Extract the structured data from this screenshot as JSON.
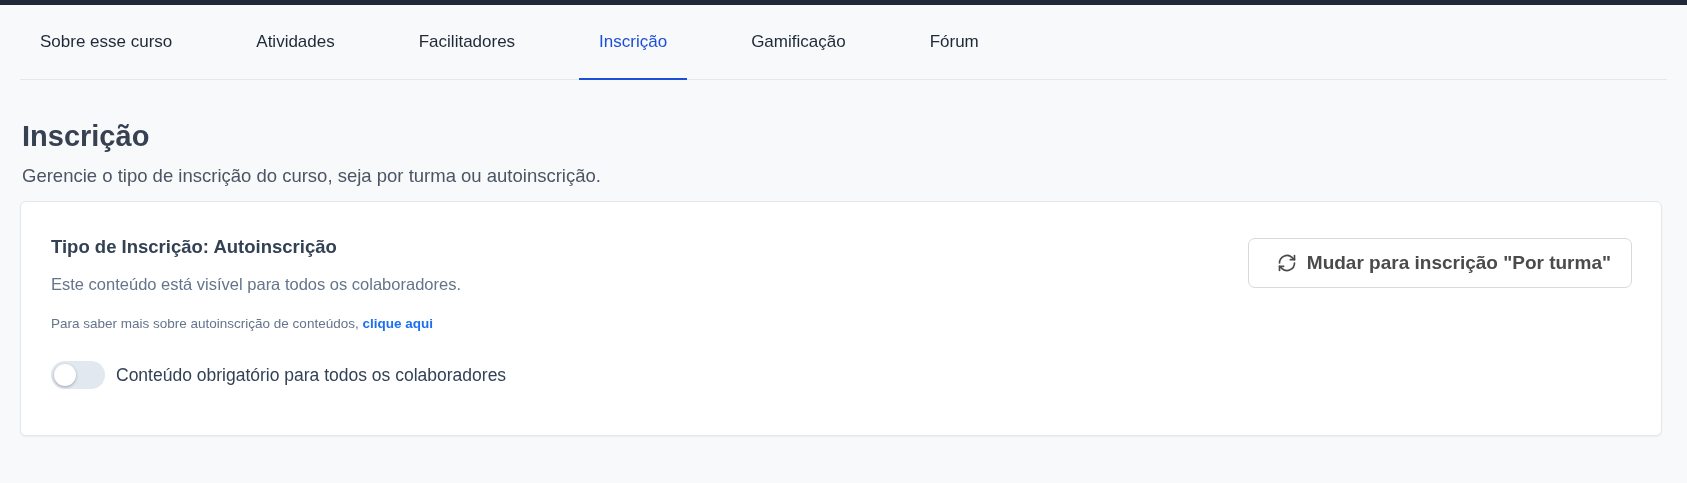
{
  "tabs": [
    {
      "label": "Sobre esse curso",
      "selected": false
    },
    {
      "label": "Atividades",
      "selected": false
    },
    {
      "label": "Facilitadores",
      "selected": false
    },
    {
      "label": "Inscrição",
      "selected": true
    },
    {
      "label": "Gamificação",
      "selected": false
    },
    {
      "label": "Fórum",
      "selected": false
    }
  ],
  "heading": "Inscrição",
  "subtitle": "Gerencie o tipo de inscrição do curso, seja por turma ou autoinscrição.",
  "card": {
    "title": "Tipo de Inscrição: Autoinscrição",
    "description": "Este conteúdo está visível para todos os colaboradores.",
    "help_text": "Para saber mais sobre autoinscrição de conteúdos,",
    "help_link": "clique aqui",
    "toggle": {
      "label": "Conteúdo obrigatório para todos os colaboradores",
      "on": false
    },
    "button": "Mudar para inscrição \"Por turma\""
  }
}
